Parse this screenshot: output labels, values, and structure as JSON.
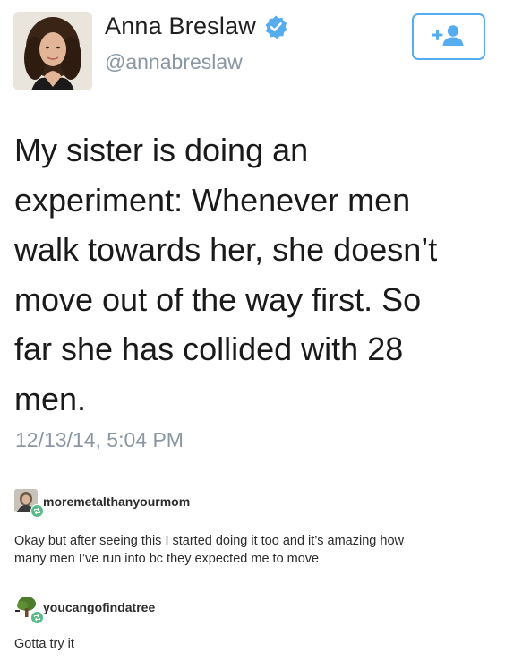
{
  "tweet": {
    "author_name": "Anna Breslaw",
    "author_handle": "@annabreslaw",
    "text_lines": [
      "My sister is doing an",
      "experiment: Whenever men",
      "walk towards her, she doesn’t",
      "move out of the way first. So",
      "far she has collided with 28",
      "men."
    ],
    "timestamp": "12/13/14, 5:04 PM",
    "verified_icon": "verified-badge-icon",
    "follow_icon": "add-user-icon",
    "accent_color": "#55acee"
  },
  "replies": [
    {
      "username": "moremetalthanyourmom",
      "text_lines": [
        "Okay but after seeing this I started doing it too and it’s amazing how",
        "many men I’ve run into bc they expected me to move"
      ]
    },
    {
      "username": "youcangofindatree",
      "text_lines": [
        "Gotta try it"
      ]
    }
  ],
  "colors": {
    "handle_gray": "#8a97a3",
    "reblog_green": "#56bc8a"
  }
}
